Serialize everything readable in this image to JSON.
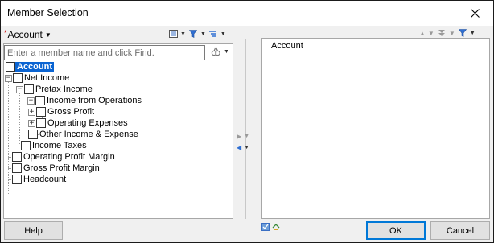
{
  "window": {
    "title": "Member Selection"
  },
  "dimension": {
    "required_marker": "*",
    "name": "Account"
  },
  "search": {
    "placeholder": "Enter a member name and click Find.",
    "value": ""
  },
  "tree": [
    {
      "label": "Account",
      "selected": true
    },
    {
      "label": "Net Income"
    },
    {
      "label": "Pretax Income"
    },
    {
      "label": "Income from Operations"
    },
    {
      "label": "Gross Profit"
    },
    {
      "label": "Operating Expenses"
    },
    {
      "label": "Other Income & Expense"
    },
    {
      "label": "Income Taxes"
    },
    {
      "label": "Operating Profit Margin"
    },
    {
      "label": "Gross Profit Margin"
    },
    {
      "label": "Headcount"
    }
  ],
  "selection": {
    "items": [
      "Account"
    ]
  },
  "buttons": {
    "help": "Help",
    "ok": "OK",
    "cancel": "Cancel"
  },
  "colors": {
    "selected_bg": "#0a64d2",
    "primary_border": "#0078d7",
    "required": "#cc0000"
  }
}
